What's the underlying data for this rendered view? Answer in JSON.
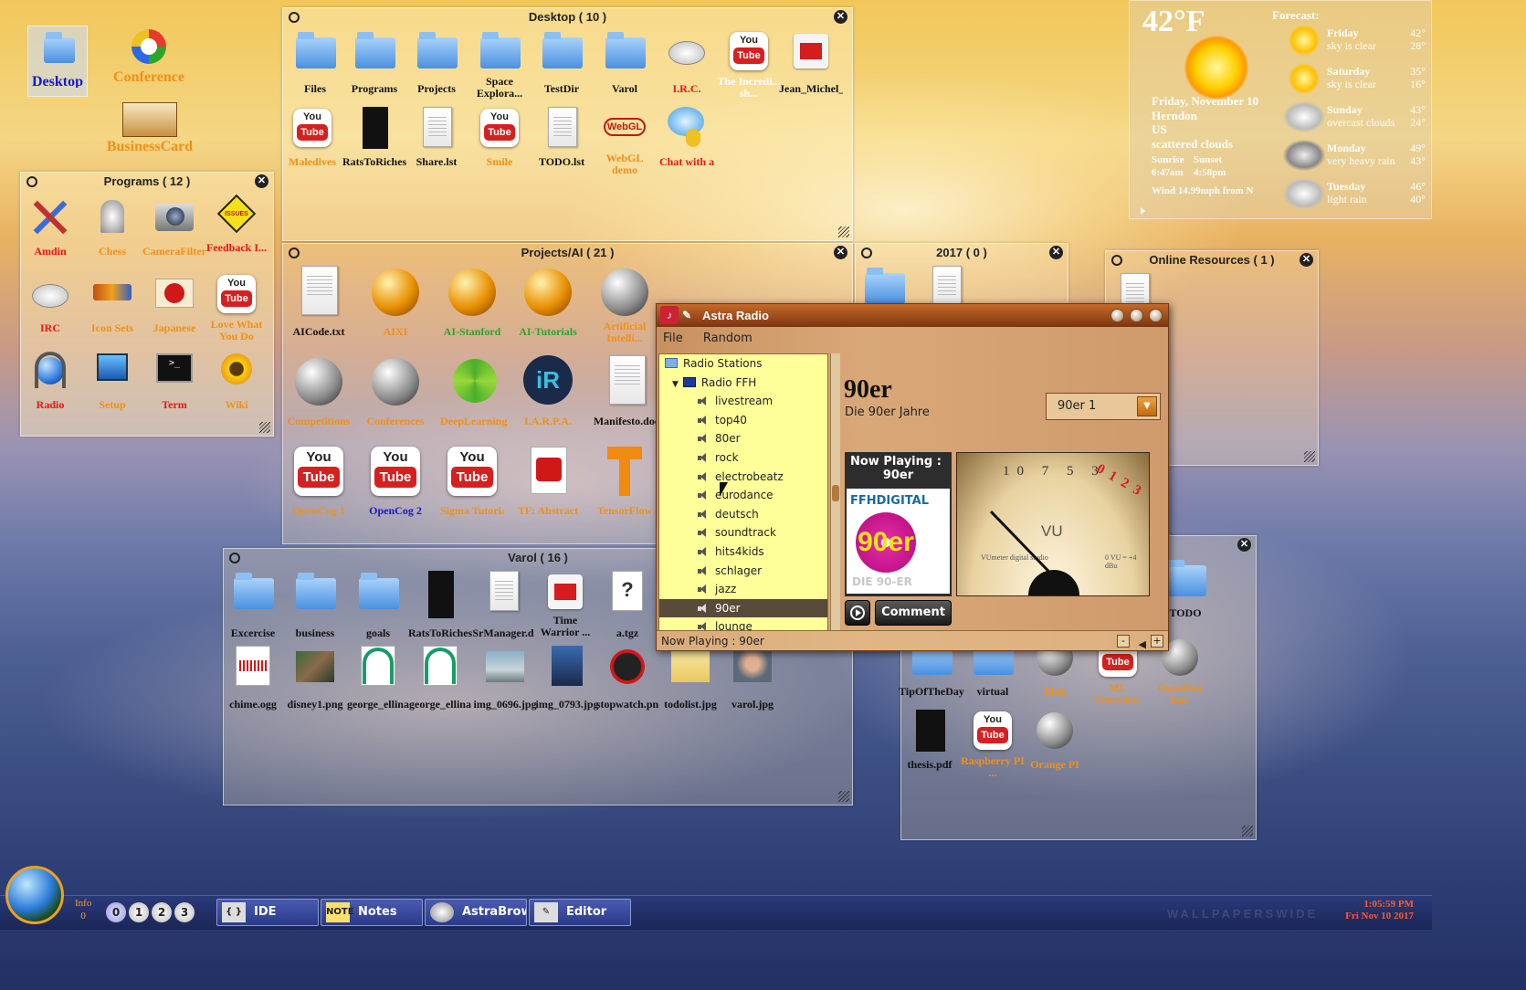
{
  "desktop_icons": [
    {
      "label": "Desktop",
      "icon": "desktop-folder-icon"
    },
    {
      "label": "Conference",
      "icon": "conference-flower-icon"
    },
    {
      "label": "BusinessCard",
      "icon": "business-card-icon"
    }
  ],
  "windows": {
    "desktop": {
      "title": "Desktop ( 10 )",
      "items": [
        "Files",
        "Programs",
        "Projects",
        "Space Explora...",
        "TestDir",
        "Varol",
        "I.R.C.",
        "The Incredi... sh...",
        "Jean_Michel_",
        "Maledives",
        "RatsToRiches",
        "Share.lst",
        "Smile",
        "TODO.lst",
        "WebGL demo",
        "Chat with a"
      ]
    },
    "programs": {
      "title": "Programs ( 12 )",
      "items": [
        "Amdin",
        "Chess",
        "CameraFilter",
        "Feedback I...",
        "IRC",
        "Icon Sets",
        "Japanese",
        "Love What You Do",
        "Radio",
        "Setup",
        "Term",
        "Wiki"
      ]
    },
    "projects_ai": {
      "title": "Projects/AI ( 21 )",
      "items": [
        "AICode.txt",
        "AIXI",
        "AI-Stanford",
        "AI-Tutorials",
        "Artificial Intelli...",
        "Competitions",
        "Conferences",
        "DeepLearning.N",
        "I.A.R.P.A.",
        "Manifesto.doc",
        "OpenCog 1",
        "OpenCog 2",
        "Sigma Tutorial",
        "TF: Abstract",
        "TensorFlow"
      ]
    },
    "year2017": {
      "title": "2017 ( 0 )"
    },
    "online": {
      "title": "Online Resources ( 1 )"
    },
    "varol": {
      "title": "Varol ( 16 )",
      "items": [
        "Excercise",
        "business",
        "goals",
        "RatsToRiches",
        "SrManager.d",
        "Time Warrior ...",
        "a.tgz",
        "chime.ogg",
        "disney1.png",
        "george_ellina",
        "george_ellina",
        "img_0696.jpg",
        "img_0793.jpg",
        "stopwatch.pn",
        "todolist.jpg",
        "varol.jpg"
      ]
    },
    "misc": {
      "items": [
        "TODO",
        "TipOfTheDay",
        "virtual",
        "Blah",
        "ML Overview",
        "OpenDoo Doc",
        "thesis.pdf",
        "Raspberry PI ...",
        "Orange PI"
      ]
    }
  },
  "radio": {
    "title": "Astra Radio",
    "menu": [
      "File",
      "Random"
    ],
    "tree_root": "Radio Stations",
    "tree_group": "Radio FFH",
    "stations": [
      "livestream",
      "top40",
      "80er",
      "rock",
      "electrobeatz",
      "eurodance",
      "deutsch",
      "soundtrack",
      "hits4kids",
      "schlager",
      "jazz",
      "90er",
      "lounge"
    ],
    "selected": "90er",
    "station_name": "90er",
    "station_desc": "Die 90er Jahre",
    "combo_value": "90er 1",
    "now_playing_label": "Now Playing :",
    "now_playing_value": "90er",
    "logo_text": "FFHDIGITAL",
    "logo_big": "90er",
    "logo_sub": "DIE 90-ER",
    "vu_label": "VU",
    "vu_scale": "10 7 5 3",
    "vu_red": "0 1 2 3",
    "vu_caption1": "VUmeter digital studio",
    "vu_caption2": "0 VU = +4 dBu",
    "comment_label": "Comment",
    "status": "Now Playing : 90er"
  },
  "weather": {
    "temp": "42°F",
    "date": "Friday, November 10",
    "city": "Herndon",
    "country": "US",
    "condition": "scattered clouds",
    "sunrise_label": "Sunrise",
    "sunset_label": "Sunset",
    "sunrise": "6:47am",
    "sunset": "4:58pm",
    "wind": "Wind 14.99mph from N",
    "forecast_label": "Forecast:",
    "forecast": [
      {
        "day": "Friday",
        "cond": "sky is clear",
        "hi": "42°",
        "lo": "28°",
        "icon": "sunny"
      },
      {
        "day": "Saturday",
        "cond": "sky is clear",
        "hi": "35°",
        "lo": "16°",
        "icon": "sunny"
      },
      {
        "day": "Sunday",
        "cond": "overcast clouds",
        "hi": "43°",
        "lo": "24°",
        "icon": "cloudy"
      },
      {
        "day": "Monday",
        "cond": "very heavy rain",
        "hi": "49°",
        "lo": "43°",
        "icon": "rain"
      },
      {
        "day": "Tuesday",
        "cond": "light rain",
        "hi": "46°",
        "lo": "40°",
        "icon": "light-rain"
      }
    ]
  },
  "taskbar": {
    "info_label": "Info",
    "info_count": "0",
    "workspaces": [
      "0",
      "1",
      "2",
      "3"
    ],
    "buttons": [
      "IDE",
      "Notes",
      "AstraBrowser",
      "Editor"
    ],
    "time": "1:05:59 PM",
    "date": "Fri Nov 10 2017",
    "watermark": "WALLPAPERSWIDE"
  }
}
